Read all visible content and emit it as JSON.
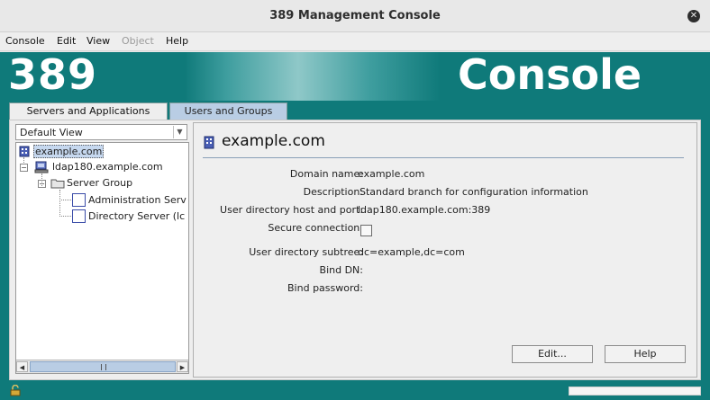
{
  "window": {
    "title": "389 Management Console"
  },
  "menu": {
    "items": [
      {
        "label": "Console",
        "enabled": true
      },
      {
        "label": "Edit",
        "enabled": true
      },
      {
        "label": "View",
        "enabled": true
      },
      {
        "label": "Object",
        "enabled": false
      },
      {
        "label": "Help",
        "enabled": true
      }
    ]
  },
  "banner": {
    "left_text": "389",
    "right_text": "Console"
  },
  "tabs": [
    {
      "label": "Servers and Applications",
      "active": true
    },
    {
      "label": "Users and Groups",
      "active": false
    }
  ],
  "view_select": {
    "value": "Default View"
  },
  "tree": {
    "nodes": [
      {
        "label": "example.com",
        "icon": "domain-icon",
        "selected": true
      },
      {
        "label": "ldap180.example.com",
        "icon": "server-host-icon",
        "expanded": true
      },
      {
        "label": "Server Group",
        "icon": "folder-icon",
        "expanded": true
      },
      {
        "label": "Administration Serv",
        "icon": "server-instance-icon"
      },
      {
        "label": "Directory Server (lc",
        "icon": "server-instance-icon"
      }
    ]
  },
  "detail": {
    "heading": "example.com",
    "fields": [
      {
        "label": "Domain name:",
        "value": "example.com"
      },
      {
        "label": "Description:",
        "value": "Standard branch for configuration information"
      },
      {
        "label": "User directory host and port:",
        "value": "ldap180.example.com:389"
      },
      {
        "label": "Secure connection:",
        "value": "",
        "checked": false
      },
      {
        "label": "User directory subtree:",
        "value": "dc=example,dc=com"
      },
      {
        "label": "Bind DN:",
        "value": ""
      },
      {
        "label": "Bind password:",
        "value": ""
      }
    ],
    "buttons": {
      "edit": "Edit...",
      "help": "Help"
    }
  },
  "colors": {
    "teal": "#0f7a7a",
    "tab_inactive": "#b9cde4",
    "selection": "#c6d8ef"
  }
}
